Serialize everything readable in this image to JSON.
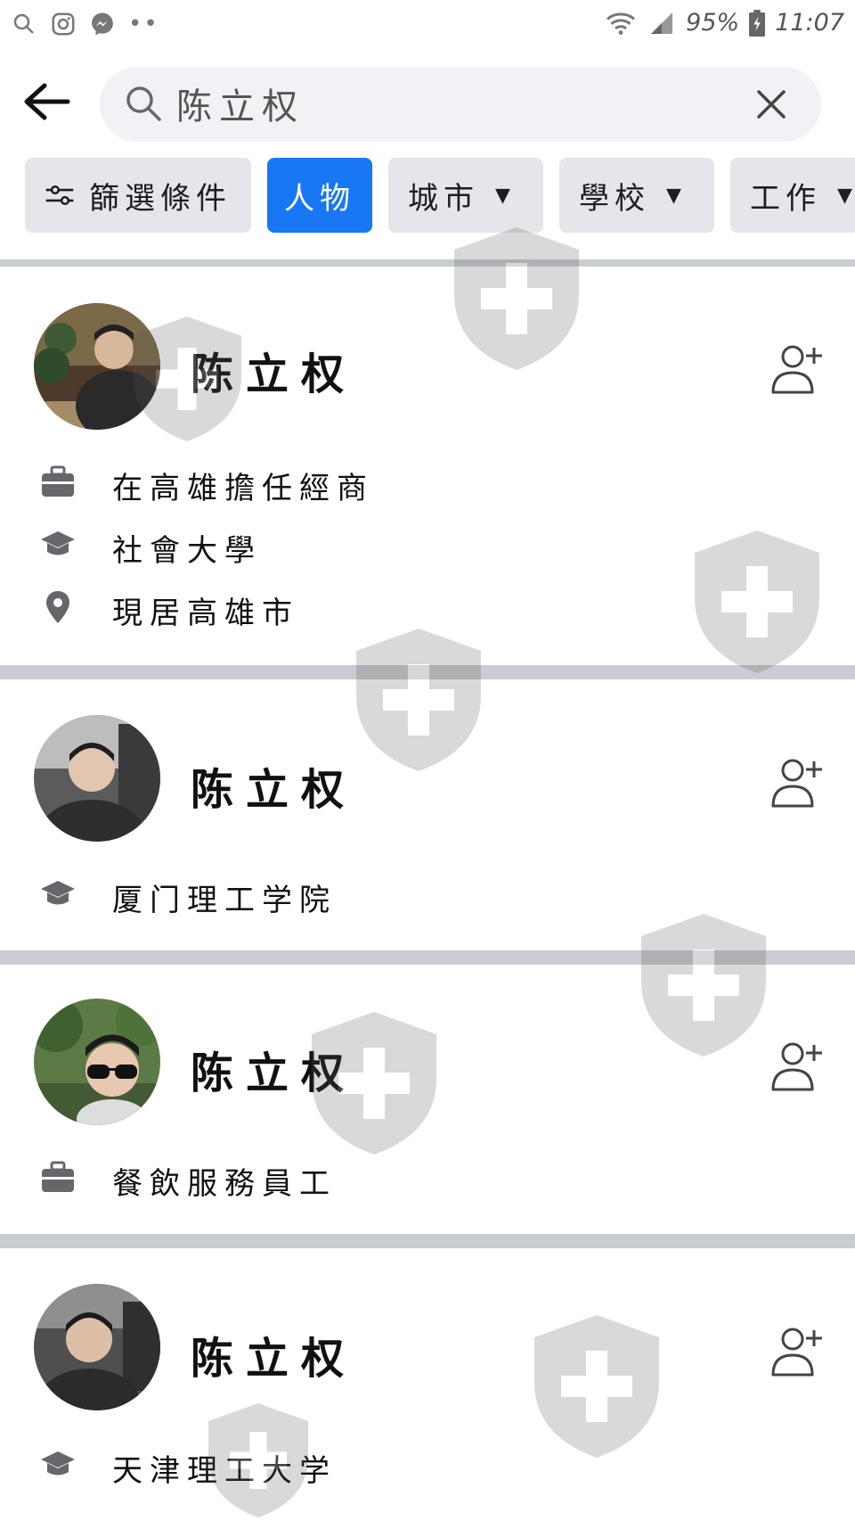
{
  "status_bar": {
    "battery": "95%",
    "time": "11:07"
  },
  "search": {
    "query": "陈立权"
  },
  "filters": [
    {
      "label": "篩選條件"
    },
    {
      "label": "人物"
    },
    {
      "label": "城市"
    },
    {
      "label": "學校"
    },
    {
      "label": "工作"
    }
  ],
  "results": [
    {
      "name": "陈立权",
      "details": [
        {
          "icon": "briefcase-icon",
          "text": "在高雄擔任經商"
        },
        {
          "icon": "graduation-cap-icon",
          "text": "社會大學"
        },
        {
          "icon": "location-pin-icon",
          "text": "現居高雄市"
        }
      ]
    },
    {
      "name": "陈立权",
      "details": [
        {
          "icon": "graduation-cap-icon",
          "text": "厦门理工学院"
        }
      ]
    },
    {
      "name": "陈立权",
      "details": [
        {
          "icon": "briefcase-icon",
          "text": "餐飲服務員工"
        }
      ]
    },
    {
      "name": "陈立权",
      "details": [
        {
          "icon": "graduation-cap-icon",
          "text": "天津理工大学"
        }
      ]
    }
  ],
  "colors": {
    "accent": "#1877f2",
    "chip_bg": "#e4e6eb",
    "divider": "#c9ccd1",
    "search_bg": "#f0f2f5"
  }
}
